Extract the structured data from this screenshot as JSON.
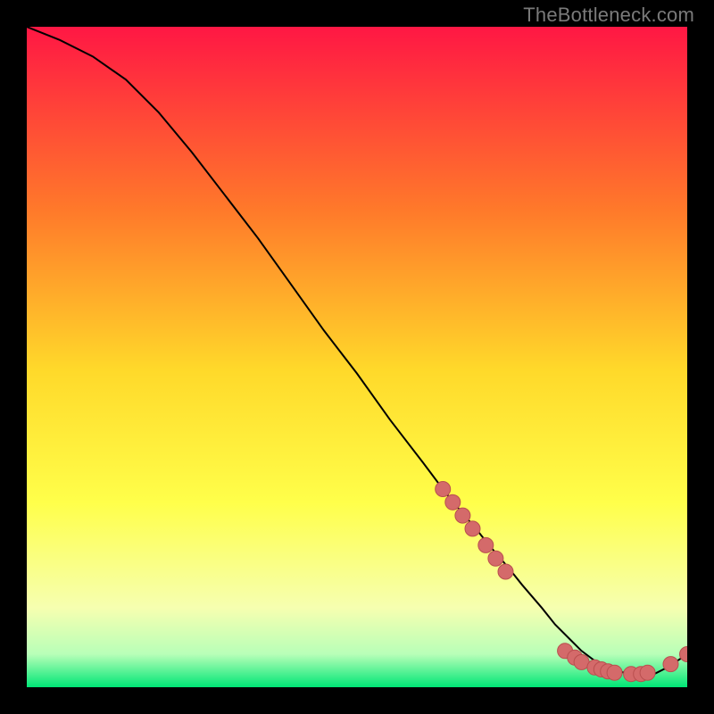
{
  "attribution": "TheBottleneck.com",
  "colors": {
    "bg": "#000000",
    "text": "#7a7a7a",
    "line": "#000000",
    "dot_fill": "#d46a6a",
    "dot_stroke": "#b94f4f",
    "grad_top": "#ff1744",
    "grad_mid1": "#ff7a2a",
    "grad_mid2": "#ffd92a",
    "grad_mid3": "#ffff4a",
    "grad_mid4": "#f6ffb0",
    "grad_mid5": "#b8ffb8",
    "grad_bottom": "#00e676"
  },
  "chart_data": {
    "type": "line",
    "title": "",
    "xlabel": "",
    "ylabel": "",
    "xlim": [
      0,
      100
    ],
    "ylim": [
      0,
      100
    ],
    "grid": false,
    "annotations": [
      "TheBottleneck.com"
    ],
    "series": [
      {
        "name": "curve",
        "x": [
          0,
          5,
          10,
          15,
          20,
          25,
          30,
          35,
          40,
          45,
          50,
          55,
          60,
          63,
          65,
          68,
          70,
          73,
          75,
          78,
          80,
          82,
          84,
          86,
          88,
          90,
          92,
          95,
          97,
          100
        ],
        "y": [
          100,
          98,
          95.5,
          92,
          87,
          81,
          74.5,
          68,
          61,
          54,
          47.5,
          40.5,
          34,
          30,
          27.5,
          24,
          21.5,
          18,
          15.5,
          12,
          9.5,
          7.5,
          5.5,
          4,
          3,
          2.3,
          2,
          2,
          3,
          5
        ]
      }
    ],
    "dot_clusters": [
      {
        "cx": 63.0,
        "cy": 30.0
      },
      {
        "cx": 64.5,
        "cy": 28.0
      },
      {
        "cx": 66.0,
        "cy": 26.0
      },
      {
        "cx": 67.5,
        "cy": 24.0
      },
      {
        "cx": 69.5,
        "cy": 21.5
      },
      {
        "cx": 71.0,
        "cy": 19.5
      },
      {
        "cx": 72.5,
        "cy": 17.5
      },
      {
        "cx": 81.5,
        "cy": 5.5
      },
      {
        "cx": 83.0,
        "cy": 4.5
      },
      {
        "cx": 84.0,
        "cy": 3.8
      },
      {
        "cx": 86.0,
        "cy": 3.0
      },
      {
        "cx": 87.0,
        "cy": 2.7
      },
      {
        "cx": 88.0,
        "cy": 2.4
      },
      {
        "cx": 89.0,
        "cy": 2.2
      },
      {
        "cx": 91.5,
        "cy": 2.0
      },
      {
        "cx": 93.0,
        "cy": 2.0
      },
      {
        "cx": 94.0,
        "cy": 2.2
      },
      {
        "cx": 97.5,
        "cy": 3.5
      },
      {
        "cx": 100.0,
        "cy": 5.0
      }
    ]
  }
}
